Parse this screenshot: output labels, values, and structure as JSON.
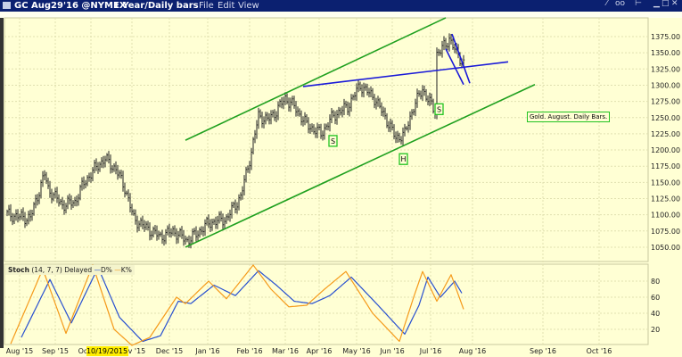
{
  "window": {
    "title": "GC Aug29'16 @NYMEX",
    "timeframe": "1 Year/Daily bars",
    "menu": [
      "File",
      "Edit",
      "View"
    ],
    "colors": {
      "titlebar": "#0b2070",
      "background": "#ffffd4",
      "channel": "#1fa01f",
      "trendline": "#1a1ad8",
      "stoch_d": "#2850d0",
      "stoch_k": "#f59a1a",
      "date_highlight": "#ffee00"
    }
  },
  "stoch_legend": {
    "name": "Stoch",
    "params": "(14, 7, 7)",
    "mode": "Delayed",
    "d_label": "D%",
    "k_label": "K%"
  },
  "annotation_box": "Gold. August. Daily Bars.",
  "highlight_date": "10/19/2015",
  "chart_data": [
    {
      "type": "bar",
      "title": "GC Aug29'16 @NYMEX 1 Year/Daily bars",
      "x_unit": "trading-bar index",
      "x_ticks": [
        "Aug '15",
        "Sep '15",
        "Oct '15",
        "Nov '15",
        "Dec '15",
        "Jan '16",
        "Feb '16",
        "Mar '16",
        "Apr '16",
        "May '16",
        "Jun '16",
        "Jul '16",
        "Aug '16",
        "Sep '16",
        "Oct '16"
      ],
      "y_ticks": [
        1050,
        1075,
        1100,
        1125,
        1150,
        1175,
        1200,
        1225,
        1250,
        1275,
        1300,
        1325,
        1350,
        1375
      ],
      "ylim": [
        1030,
        1400
      ],
      "grid": true,
      "close_path": [
        [
          0,
          1101
        ],
        [
          6,
          1097
        ],
        [
          13,
          1095
        ],
        [
          21,
          1163
        ],
        [
          23,
          1140
        ],
        [
          31,
          1115
        ],
        [
          38,
          1120
        ],
        [
          43,
          1149
        ],
        [
          51,
          1177
        ],
        [
          55,
          1186
        ],
        [
          61,
          1170
        ],
        [
          66,
          1142
        ],
        [
          71,
          1094
        ],
        [
          78,
          1080
        ],
        [
          86,
          1066
        ],
        [
          93,
          1075
        ],
        [
          101,
          1060
        ],
        [
          106,
          1070
        ],
        [
          113,
          1087
        ],
        [
          123,
          1094
        ],
        [
          131,
          1128
        ],
        [
          137,
          1197
        ],
        [
          141,
          1253
        ],
        [
          146,
          1246
        ],
        [
          151,
          1260
        ],
        [
          156,
          1280
        ],
        [
          161,
          1267
        ],
        [
          168,
          1239
        ],
        [
          176,
          1225
        ],
        [
          183,
          1253
        ],
        [
          191,
          1267
        ],
        [
          198,
          1300
        ],
        [
          206,
          1280
        ],
        [
          213,
          1246
        ],
        [
          218,
          1218
        ],
        [
          223,
          1225
        ],
        [
          228,
          1267
        ],
        [
          233,
          1294
        ],
        [
          237,
          1273
        ],
        [
          240,
          1260
        ],
        [
          241,
          1349
        ],
        [
          246,
          1362
        ],
        [
          248,
          1373
        ],
        [
          252,
          1349
        ],
        [
          256,
          1335
        ]
      ],
      "trendlines": [
        {
          "name": "upper-channel",
          "color": "#1fa01f",
          "from": [
            100,
            1215
          ],
          "to": [
            246,
            1404
          ]
        },
        {
          "name": "lower-channel",
          "color": "#1fa01f",
          "from": [
            100,
            1050
          ],
          "to": [
            296,
            1301
          ]
        },
        {
          "name": "neckline",
          "color": "#1a1ad8",
          "from": [
            166,
            1298
          ],
          "to": [
            281,
            1336
          ]
        },
        {
          "name": "wedge-upper",
          "color": "#1a1ad8",
          "from": [
            249.5,
            1379
          ],
          "to": [
            259.5,
            1303
          ]
        },
        {
          "name": "wedge-lower",
          "color": "#1a1ad8",
          "from": [
            246,
            1356
          ],
          "to": [
            256,
            1301
          ]
        }
      ],
      "pattern_labels": [
        {
          "text": "S",
          "at": [
            182.5,
            1214
          ]
        },
        {
          "text": "H",
          "at": [
            222,
            1186
          ]
        },
        {
          "text": "S",
          "at": [
            242,
            1263
          ]
        }
      ]
    },
    {
      "type": "line",
      "title": "Stoch (14, 7, 7)",
      "y_ticks": [
        20,
        40,
        60,
        80
      ],
      "ylim": [
        0,
        100
      ],
      "series": [
        {
          "name": "D%",
          "points": [
            [
              8,
              10
            ],
            [
              24,
              82
            ],
            [
              36,
              28
            ],
            [
              51,
              97
            ],
            [
              63,
              35
            ],
            [
              76,
              5
            ],
            [
              86,
              12
            ],
            [
              96,
              55
            ],
            [
              103,
              52
            ],
            [
              116,
              75
            ],
            [
              128,
              62
            ],
            [
              141,
              93
            ],
            [
              151,
              75
            ],
            [
              161,
              55
            ],
            [
              171,
              52
            ],
            [
              181,
              62
            ],
            [
              193,
              85
            ],
            [
              208,
              50
            ],
            [
              223,
              14
            ],
            [
              231,
              50
            ],
            [
              236,
              85
            ],
            [
              243,
              60
            ],
            [
              251,
              80
            ],
            [
              255,
              65
            ]
          ]
        },
        {
          "name": "K%",
          "points": [
            [
              2,
              2
            ],
            [
              20,
              95
            ],
            [
              33,
              15
            ],
            [
              48,
              100
            ],
            [
              60,
              20
            ],
            [
              70,
              0
            ],
            [
              80,
              10
            ],
            [
              95,
              60
            ],
            [
              100,
              52
            ],
            [
              113,
              80
            ],
            [
              123,
              58
            ],
            [
              138,
              100
            ],
            [
              148,
              70
            ],
            [
              158,
              48
            ],
            [
              168,
              50
            ],
            [
              178,
              70
            ],
            [
              190,
              92
            ],
            [
              205,
              40
            ],
            [
              220,
              5
            ],
            [
              228,
              60
            ],
            [
              233,
              92
            ],
            [
              241,
              55
            ],
            [
              249,
              88
            ],
            [
              256,
              45
            ]
          ]
        }
      ]
    }
  ]
}
